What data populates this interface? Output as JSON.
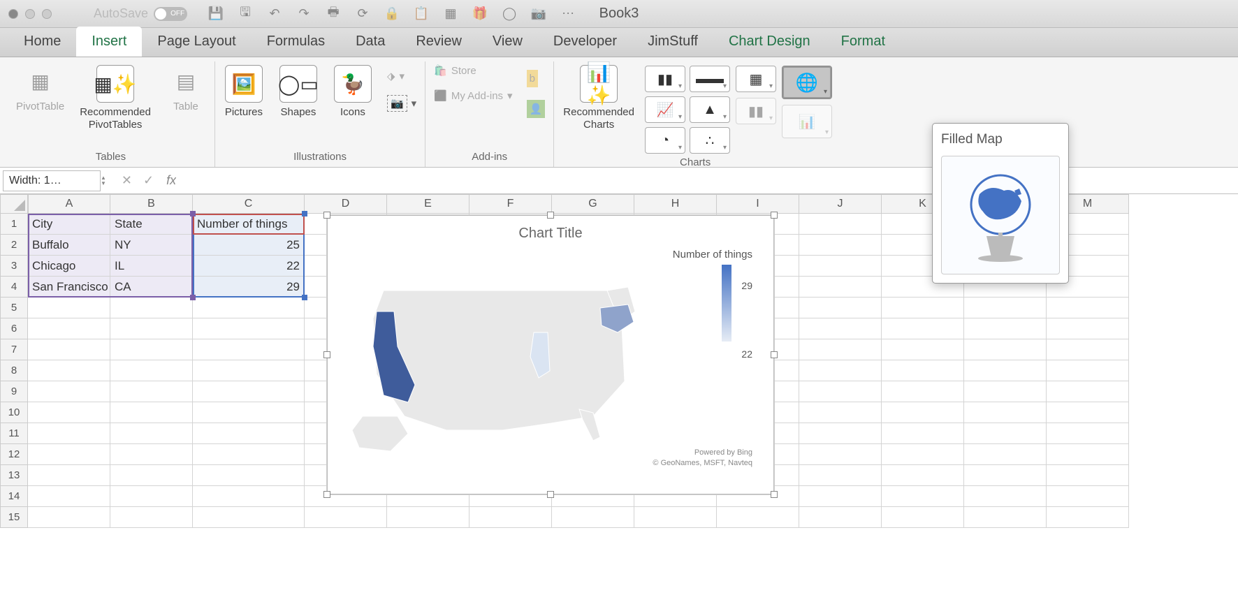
{
  "titlebar": {
    "autosave_label": "AutoSave",
    "autosave_state": "OFF",
    "window_title": "Book3"
  },
  "tabs": [
    "Home",
    "Insert",
    "Page Layout",
    "Formulas",
    "Data",
    "Review",
    "View",
    "Developer",
    "JimStuff",
    "Chart Design",
    "Format"
  ],
  "active_tab": "Insert",
  "ribbon": {
    "tables": {
      "pivot": "PivotTable",
      "recpivot": "Recommended\nPivotTables",
      "table": "Table",
      "group": "Tables"
    },
    "illus": {
      "pictures": "Pictures",
      "shapes": "Shapes",
      "icons": "Icons",
      "group": "Illustrations"
    },
    "addins": {
      "store": "Store",
      "my": "My Add-ins",
      "group": "Add-ins"
    },
    "charts": {
      "rec": "Recommended\nCharts",
      "group": "Charts"
    },
    "map_popup_title": "Filled Map"
  },
  "formula_bar": {
    "namebox": "Width: 1…"
  },
  "columns": [
    "A",
    "B",
    "C",
    "D",
    "E",
    "F",
    "G",
    "H",
    "I",
    "J",
    "K",
    "L",
    "M"
  ],
  "sheet": {
    "headers": [
      "City",
      "State",
      "Number of things"
    ],
    "rows": [
      {
        "city": "Buffalo",
        "state": "NY",
        "val": "25"
      },
      {
        "city": "Chicago",
        "state": "IL",
        "val": "22"
      },
      {
        "city": "San Francisco",
        "state": "CA",
        "val": "29"
      }
    ]
  },
  "chart": {
    "title": "Chart Title",
    "legend_title": "Number of things",
    "legend_max": "29",
    "legend_min": "22",
    "attrib1": "Powered by Bing",
    "attrib2": "© GeoNames, MSFT, Navteq"
  },
  "chart_data": {
    "type": "map",
    "region": "US states",
    "measure": "Number of things",
    "series": [
      {
        "name": "NY",
        "value": 25
      },
      {
        "name": "IL",
        "value": 22
      },
      {
        "name": "CA",
        "value": 29
      }
    ],
    "color_scale": {
      "min": 22,
      "max": 29,
      "min_color": "#e6ecf5",
      "max_color": "#4472c4"
    },
    "title": "Chart Title"
  }
}
